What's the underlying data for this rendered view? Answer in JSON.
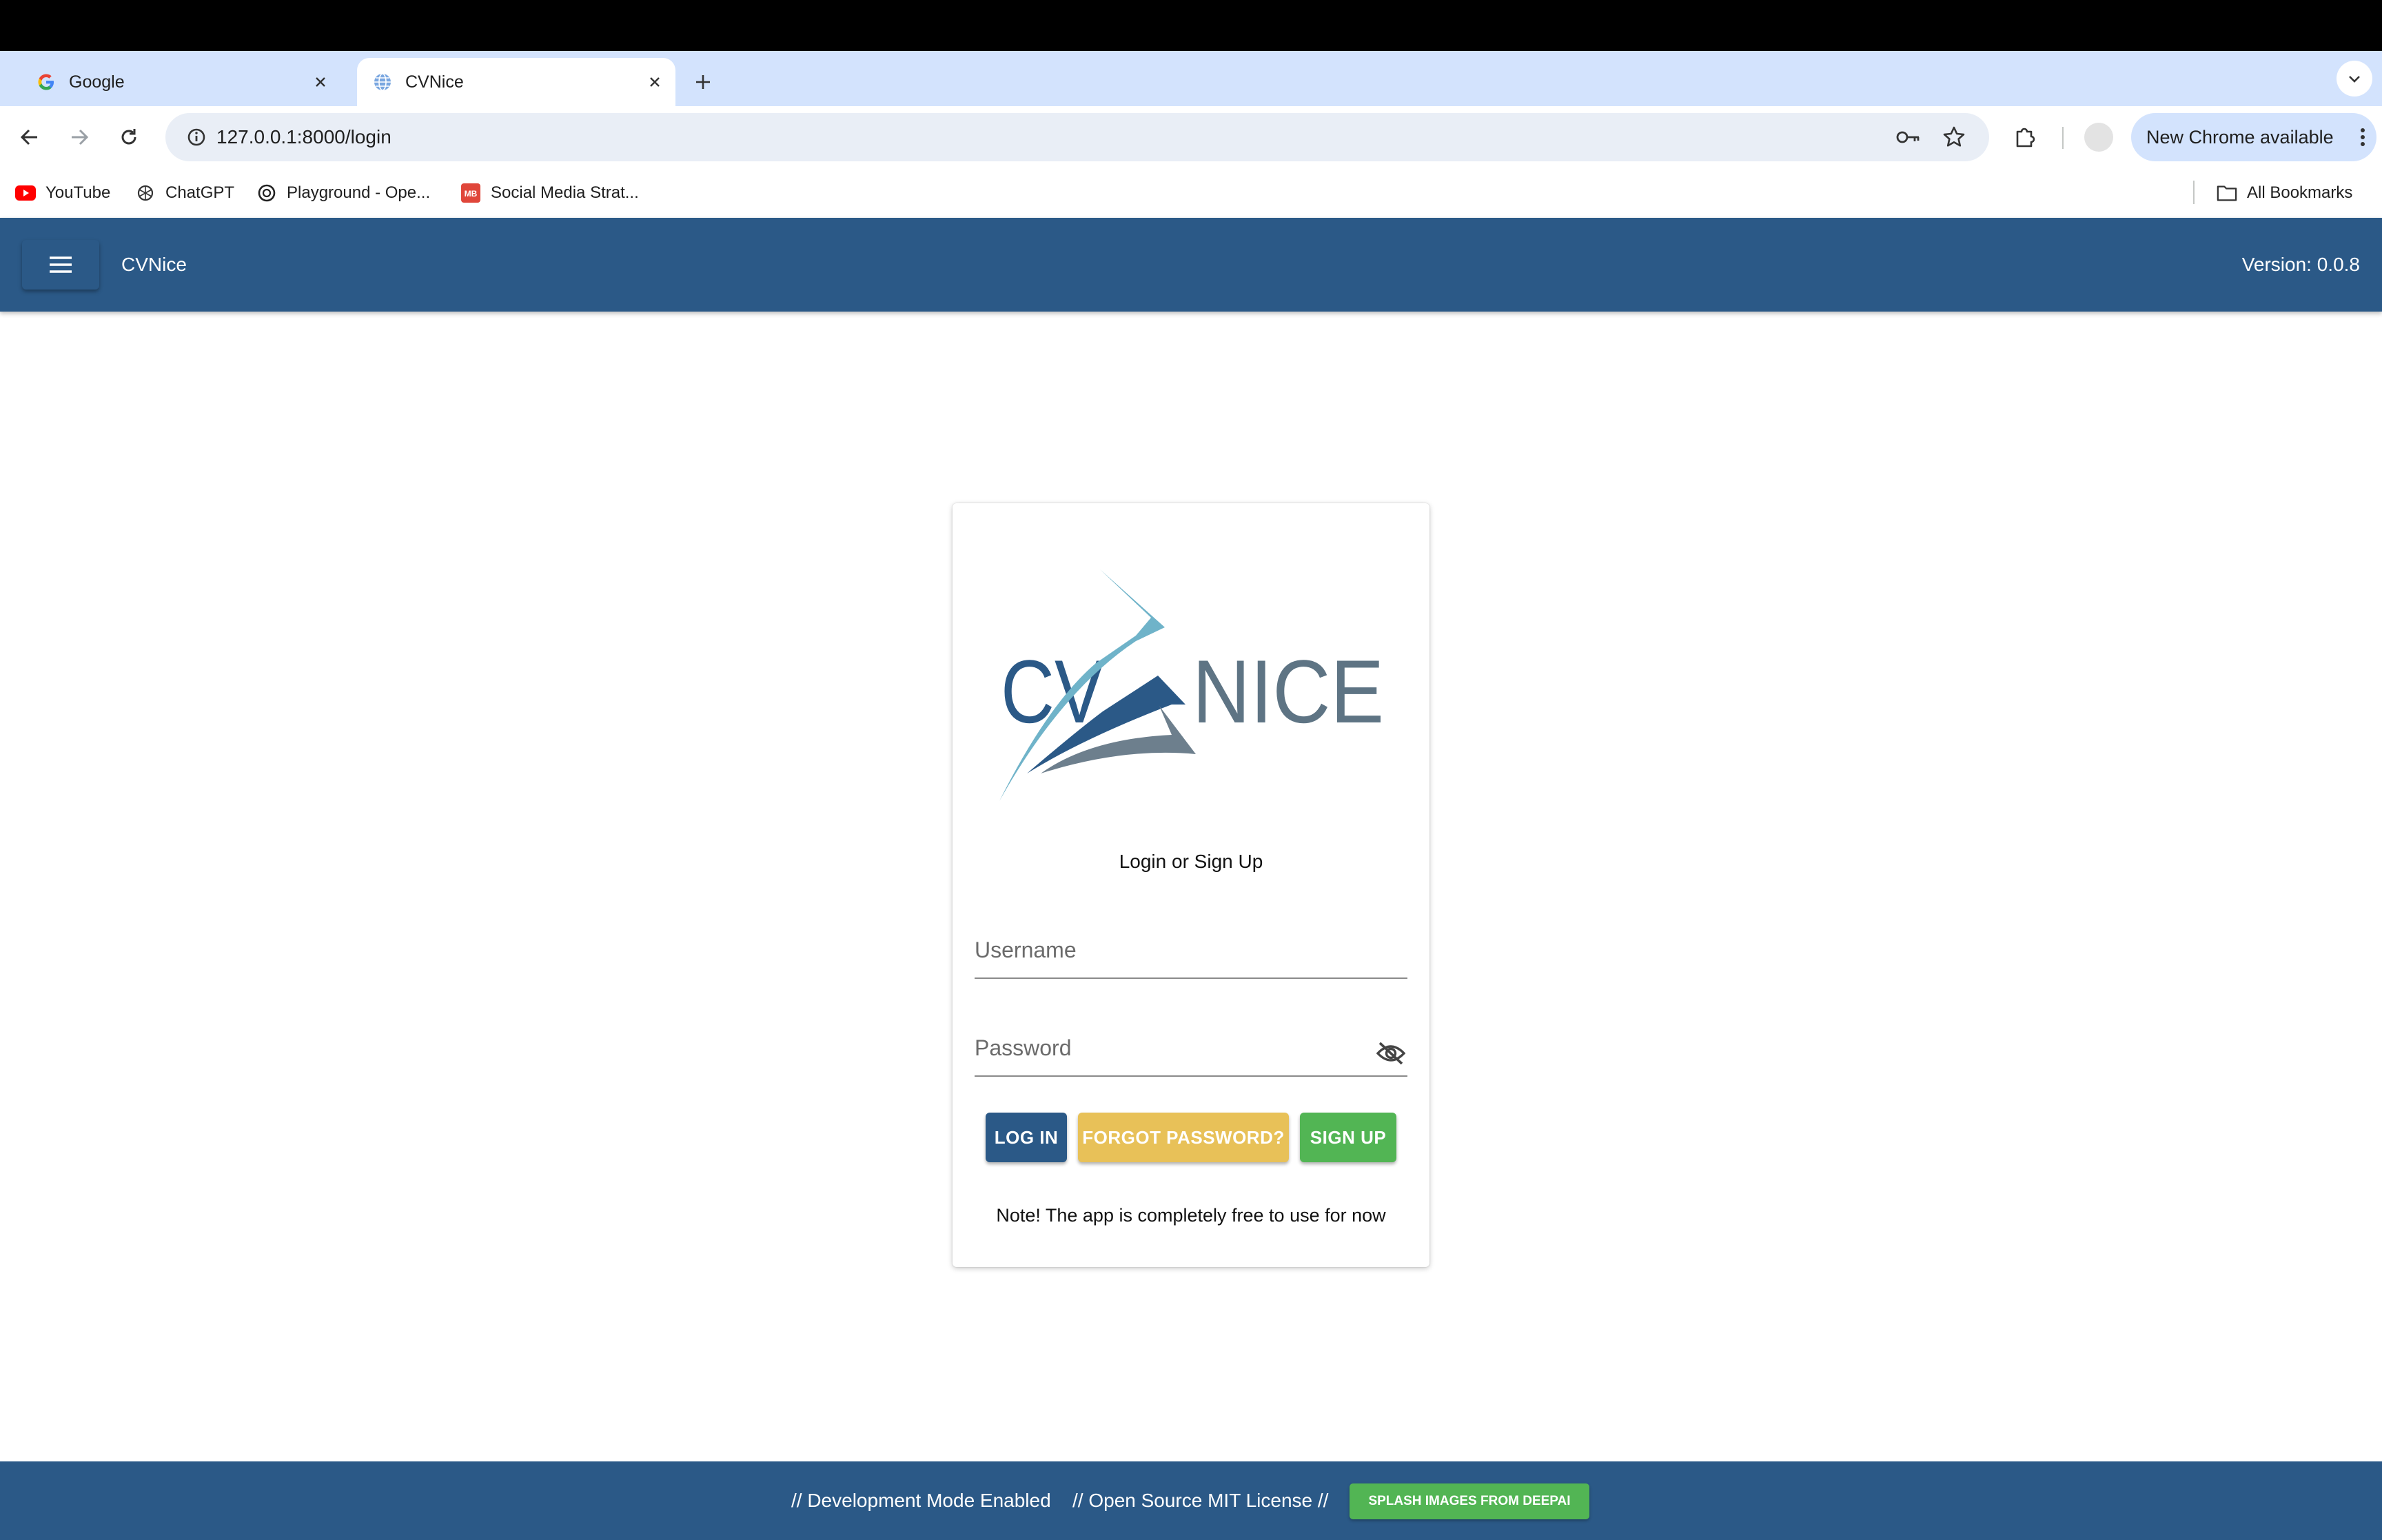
{
  "browser": {
    "tabs": [
      {
        "title": "Google",
        "icon": "google-icon"
      },
      {
        "title": "CVNice",
        "icon": "globe-icon"
      }
    ],
    "url": "127.0.0.1:8000/login",
    "update_label": "New Chrome available",
    "bookmarks": [
      {
        "label": "YouTube",
        "icon": "youtube-icon"
      },
      {
        "label": "ChatGPT",
        "icon": "chatgpt-icon"
      },
      {
        "label": "Playground - Ope...",
        "icon": "openai-icon"
      },
      {
        "label": "Social Media Strat...",
        "icon": "mb-icon"
      }
    ],
    "all_bookmarks_label": "All Bookmarks"
  },
  "app": {
    "title": "CVNice",
    "version": "Version: 0.0.8",
    "header_color": "#2b5987"
  },
  "login": {
    "logo_text_left": "CV",
    "logo_text_right": "NICE",
    "subtitle": "Login or Sign Up",
    "username_label": "Username",
    "password_label": "Password",
    "buttons": {
      "login": "LOG IN",
      "forgot": "FORGOT PASSWORD?",
      "signup": "SIGN UP"
    },
    "note": "Note! The app is completely free to use for now",
    "colors": {
      "login": "#2b5987",
      "forgot": "#e8c158",
      "signup": "#52b554"
    }
  },
  "footer": {
    "dev_mode": "// Development Mode Enabled",
    "license": "// Open Source MIT License //",
    "splash_button": "SPLASH IMAGES FROM DEEPAI"
  }
}
